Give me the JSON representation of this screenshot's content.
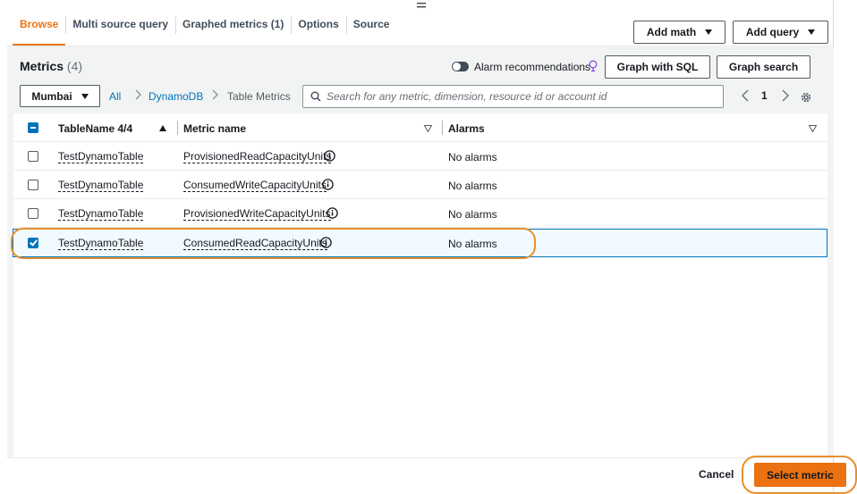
{
  "colors": {
    "accent": "#ec7211",
    "link": "#0073bb",
    "highlight_ring": "#e8902c",
    "panel_bg": "#f2f3f3"
  },
  "tabs": [
    {
      "label": "Browse",
      "active": true
    },
    {
      "label": "Multi source query",
      "active": false
    },
    {
      "label": "Graphed metrics (1)",
      "active": false
    },
    {
      "label": "Options",
      "active": false
    },
    {
      "label": "Source",
      "active": false
    }
  ],
  "toolbar": {
    "add_math": "Add math",
    "add_query": "Add query"
  },
  "metrics": {
    "title": "Metrics",
    "count": "(4)",
    "alarm_recommendations": "Alarm recommendations",
    "graph_with_sql": "Graph with SQL",
    "graph_search": "Graph search"
  },
  "nav": {
    "region": "Mumbai",
    "breadcrumbs": [
      {
        "label": "All",
        "link": true
      },
      {
        "label": "DynamoDB",
        "link": true
      },
      {
        "label": "Table Metrics",
        "link": false
      }
    ],
    "search_placeholder": "Search for any metric, dimension, resource id or account id",
    "page": "1"
  },
  "table": {
    "columns": {
      "table_name": "TableName 4/4",
      "metric_name": "Metric name",
      "alarms": "Alarms"
    },
    "rows": [
      {
        "checked": false,
        "table": "TestDynamoTable",
        "metric": "ProvisionedReadCapacityUnits",
        "alarms": "No alarms"
      },
      {
        "checked": false,
        "table": "TestDynamoTable",
        "metric": "ConsumedWriteCapacityUnits",
        "alarms": "No alarms"
      },
      {
        "checked": false,
        "table": "TestDynamoTable",
        "metric": "ProvisionedWriteCapacityUnits",
        "alarms": "No alarms"
      },
      {
        "checked": true,
        "table": "TestDynamoTable",
        "metric": "ConsumedReadCapacityUnits",
        "alarms": "No alarms"
      }
    ]
  },
  "footer": {
    "cancel": "Cancel",
    "select_metric": "Select metric"
  },
  "icons": [
    "drag-handle-icon",
    "chevron-down-icon",
    "lightbulb-icon",
    "chevron-right-icon",
    "search-icon",
    "chevron-left-icon",
    "settings-gear-icon",
    "sort-ascending-icon",
    "filter-triangle-icon",
    "info-icon"
  ]
}
